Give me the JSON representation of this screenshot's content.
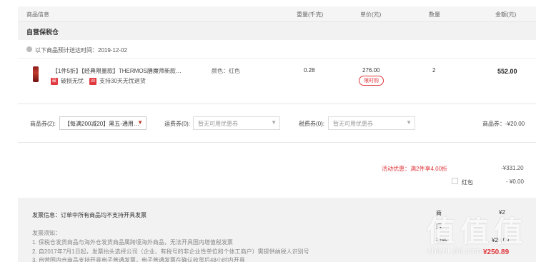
{
  "header": {
    "product_info": "商品信息",
    "weight": "重量(千克)",
    "unit_price": "单价(元)",
    "quantity": "数量",
    "amount": "金额(元)"
  },
  "warehouse": {
    "name": "自营保税仓"
  },
  "shipping": {
    "label": "以下商品预计送达时间：2019-12-02"
  },
  "item": {
    "title": "【1件5折】【经典限量款】THERMOS膳魔师新款…",
    "tag1": "破损无忧",
    "tag2": "支持30天无忧退货",
    "tag1_icon": "破",
    "tag2_icon": "30",
    "color": "颜色：红色",
    "weight": "0.28",
    "price": "276.00",
    "limit_badge": "限时购",
    "qty": "2",
    "amount": "552.00"
  },
  "coupons": {
    "product_label": "商品券(2):",
    "product_value": "【每满200减20】黑五-通用…",
    "shipping_label": "运费券(0):",
    "shipping_placeholder": "暂无可用优惠券",
    "tax_label": "税费券(0):",
    "tax_placeholder": "暂无可用优惠券",
    "product_total": "商品券：-¥20.00"
  },
  "promo": {
    "label": "活动优惠：满2件享4.00折",
    "value": "-¥331.20"
  },
  "red_packet": {
    "label": "红包",
    "value": "- ¥0.00"
  },
  "invoice": {
    "title": "发票信息：订单中所有商品均不支持开具发票",
    "notice_title": "发票须知：",
    "line1": "1. 保税仓发货商品与海外仓发货商品属跨境海外商品，无法开具国内增值税发票",
    "line2": "2. 自2017年7月1日起，发票抬头选择公司（企业、有税号的非企业性单位和个体工商户）需提供纳税人识别号",
    "line3": "3. 自营国内仓商品支持开具电子普通发票，电子普通发票在确认收货后48小时内开具"
  },
  "summary": {
    "row1_label": "商",
    "row1_value": "¥2",
    "row2_label": "运",
    "row3_label": "税费",
    "row3_value": "¥20.09",
    "row4_value": "¥250.89"
  },
  "watermark": {
    "logo": "值 值 值",
    "site": "zhizhi.zhi.com"
  },
  "colors": {
    "accent": "#e0383e",
    "panel": "#f2f2f2"
  }
}
